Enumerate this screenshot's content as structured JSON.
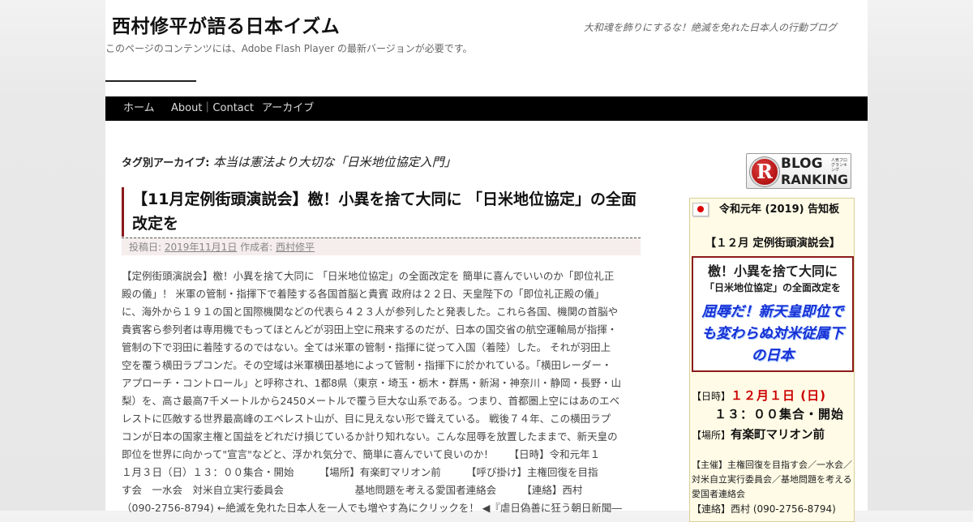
{
  "site": {
    "title": "西村修平が語る日本イズム",
    "description": "大和魂を飾りにするな！絶滅を免れた日本人の行動ブログ",
    "flash_notice": "このページのコンテンツには、Adobe Flash Player の最新バージョンが必要です。"
  },
  "nav": {
    "items": [
      {
        "label": "ホーム"
      },
      {
        "label": "About｜Contact"
      },
      {
        "label": "アーカイブ"
      }
    ]
  },
  "archive": {
    "label": "タグ別アーカイブ:",
    "tag": "本当は憲法より大切な「日米地位協定入門」"
  },
  "post": {
    "title": "【11月定例街頭演説会】檄！小異を捨て大同に 「日米地位協定」の全面改定を",
    "meta_posted_label": "投稿日:",
    "meta_date": "2019年11月1日",
    "meta_author_label": "作成者:",
    "meta_author": "西村修平",
    "body_lines": [
      "【定例街頭演説会】檄！小異を捨て大同に 「日米地位協定」の全面改定を 簡単に喜んでいいのか「即位礼正",
      "殿の儀」！ 米軍の管制・指揮下で着陸する各国首脳と貴賓 政府は２２日、天皇陛下の「即位礼正殿の儀」",
      "に、海外から１９１の国と国際機関などの代表ら４２３人が参列したと発表した。これら各国、機関の首脳や",
      "貴賓客ら参列者は専用機でもってほとんどが羽田上空に飛来するのだが、日本の国交省の航空運輸局が指揮・",
      "管制の下で羽田に着陸するのではない。全ては米軍の管制・指揮に従って入国（着陸）した。 それが羽田上",
      "空を覆う横田ラプコンだ。その空域は米軍横田基地によって管制・指揮下に於かれている。「横田レーダー・",
      "アプローチ・コントロール」と呼称され、1都8県（東京・埼玉・栃木・群馬・新潟・神奈川・静岡・長野・山",
      "梨）を、高さ最高7千メートルから2450メートルで覆う巨大な山系である。つまり、首都圏上空にはあのエベ",
      "レストに匹敵する世界最高峰のエベレスト山が、目に見えない形で聳えている。 戦後７４年、この横田ラプ",
      "コンが日本の国家主権と国益をどれだけ損じているか計り知れない。こんな屈辱を放置したままで、新天皇の",
      "即位を世界に向かって\"宣言\"などと、浮かれ気分で、簡単に喜んでいて良いのか！　　【日時】令和元年１",
      "１月３日（日）１３：００集合・開始　　　【場所】有楽町マリオン前　　　【呼び掛け】主権回復を目指",
      "す会　一水会　対米自立実行委員会　　　　　　　基地問題を考える愛国者連絡会　　　【連絡】西村",
      "（090-2756-8794) ←絶滅を免れた日本人を一人でも増やす為にクリックを！ ◀『虐日偽善に狂う朝日新聞―"
    ]
  },
  "sidebar": {
    "ranking_badge": {
      "letter": "R",
      "line1": "BLOG",
      "line2": "RANKING",
      "small": "人気ブログランキング"
    },
    "notice": {
      "year_title": "令和元年 (2019) 告知板",
      "event_title": "【１２月 定例街頭演説会】",
      "headline_1": "檄！小異を捨て大同に",
      "headline_2": "「日米地位協定」の全面改定を",
      "slogan": "屈辱だ！新天皇即位でも変わらぬ対米従属下の日本",
      "date_label": "【日時】",
      "date_value": "１２月１日 (日)",
      "time_value": "１３：００集合・開始",
      "place_label": "【場所】",
      "place_value": "有楽町マリオン前",
      "host_label": "【主催】",
      "host_value": "主権回復を目指す会／一水会／対米自立実行委員会／基地問題を考える愛国者連絡会",
      "contact_label": "【連絡】",
      "contact_value": "西村 (090-2756-8794)"
    }
  },
  "colors": {
    "nav_background": "#000000",
    "post_title_border": "#8a1a1a",
    "slogan_blue": "#1730d6",
    "date_red": "#cc0000",
    "notice_background": "#fffbe6"
  }
}
